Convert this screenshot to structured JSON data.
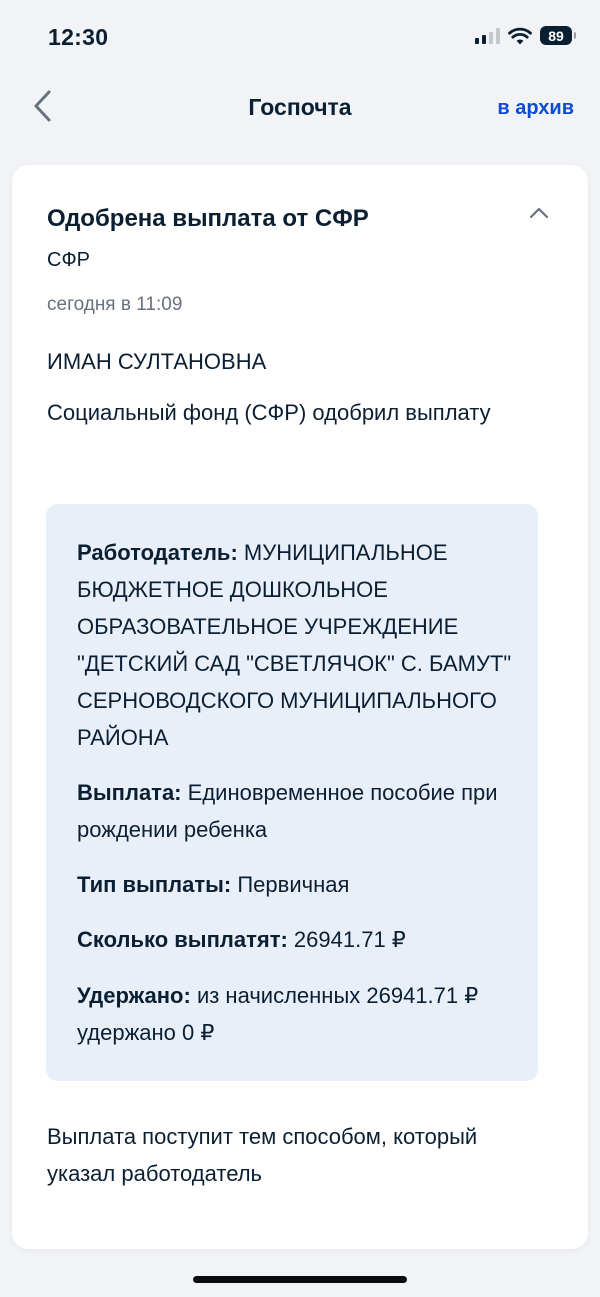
{
  "status_bar": {
    "time": "12:30",
    "battery": "89"
  },
  "nav": {
    "title": "Госпочта",
    "archive_label": "в архив"
  },
  "message": {
    "title": "Одобрена выплата от СФР",
    "sender": "СФР",
    "date": "сегодня в 11:09",
    "recipient": "ИМАН СУЛТАНОВНА",
    "summary": "Социальный фонд (СФР) одобрил выплату",
    "details": {
      "employer_label": "Работодатель:",
      "employer_value": "МУНИЦИПАЛЬНОЕ БЮДЖЕТНОЕ ДОШКОЛЬНОЕ ОБРАЗОВАТЕЛЬНОЕ УЧРЕЖДЕНИЕ \"ДЕТСКИЙ САД \"СВЕТЛЯЧОК\" С. БАМУТ\" СЕРНОВОДСКОГО МУНИЦИПАЛЬНОГО РАЙОНА",
      "payment_label": "Выплата:",
      "payment_value": "Единовременное пособие при рождении ребенка",
      "type_label": "Тип выплаты:",
      "type_value": "Первичная",
      "amount_label": "Сколько выплатят:",
      "amount_value": "26941.71 ₽",
      "withheld_label": "Удержано:",
      "withheld_value": "из начисленных 26941.71 ₽ удержано 0 ₽"
    },
    "footer": "Выплата поступит тем способом, который указал работодатель"
  },
  "colors": {
    "accent": "#0d4cd3",
    "text": "#0b1f33",
    "muted": "#66727f",
    "details_bg": "#e9eff9",
    "page_bg": "#f1f3f6"
  },
  "icons": {
    "back": "chevron-left-icon",
    "collapse": "chevron-up-icon",
    "signal": "cellular-signal-icon",
    "wifi": "wifi-icon",
    "battery": "battery-icon"
  }
}
